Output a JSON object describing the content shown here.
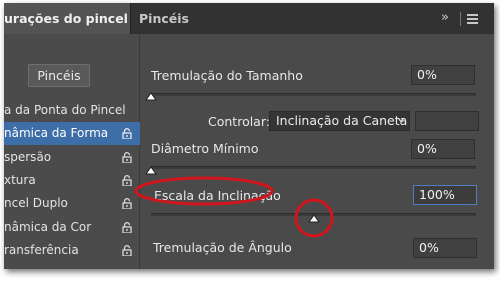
{
  "tabs": {
    "active_label": "urações do pincel",
    "inactive_label": "Pincéis",
    "collapse_glyph": "»"
  },
  "sidebar": {
    "brushes_button": "Pincéis",
    "items": [
      {
        "label": "a da Ponta do Pincel",
        "selected": false,
        "locked": false
      },
      {
        "label": "nâmica da Forma",
        "selected": true,
        "locked": true
      },
      {
        "label": "spersão",
        "selected": false,
        "locked": true
      },
      {
        "label": "xtura",
        "selected": false,
        "locked": true
      },
      {
        "label": "ncel Duplo",
        "selected": false,
        "locked": true
      },
      {
        "label": "nâmica da Cor",
        "selected": false,
        "locked": true
      },
      {
        "label": "ransferência",
        "selected": false,
        "locked": true
      }
    ]
  },
  "main": {
    "size_jitter": {
      "label": "Tremulação do Tamanho",
      "value": "0%",
      "slider_level": 0
    },
    "control": {
      "label": "Controlar:",
      "selected": "Inclinação da Caneta",
      "value": ""
    },
    "min_diameter": {
      "label": "Diâmetro Mínimo",
      "value": "0%",
      "slider_level": 0
    },
    "tilt_scale": {
      "label": "Escala da Inclinação",
      "value": "100%",
      "slider_level": 0.5
    },
    "angle_jitter": {
      "label": "Tremulação de Ângulo",
      "value": "0%"
    }
  },
  "colors": {
    "panel": "#4a4a4a",
    "selected": "#3d6ea8",
    "annotation": "#d0151c"
  },
  "icons": {
    "lock": "lock-icon",
    "chevron": "chevron-down-icon",
    "menu": "hamburger-menu-icon"
  }
}
